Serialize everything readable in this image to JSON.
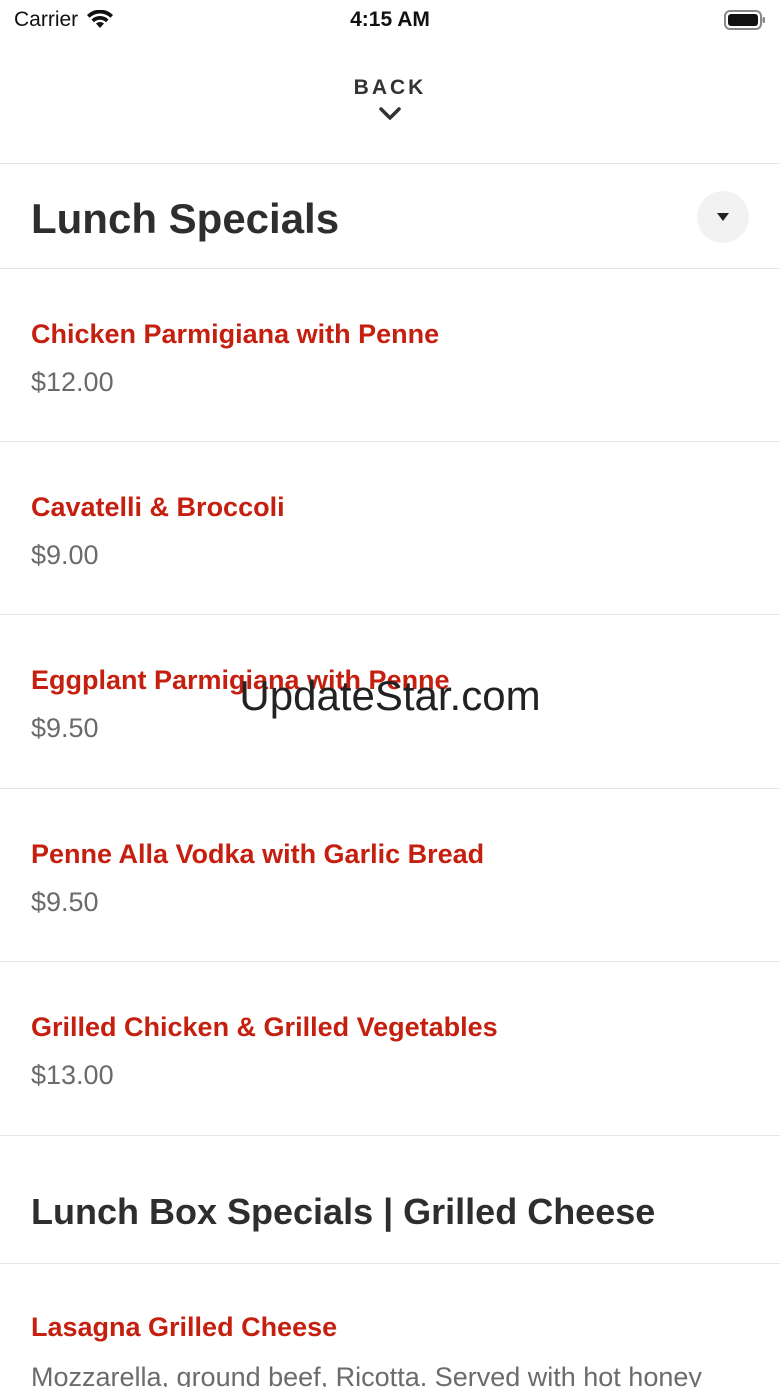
{
  "status_bar": {
    "carrier": "Carrier",
    "time": "4:15 AM",
    "icons": [
      "wifi-icon",
      "battery-icon"
    ]
  },
  "nav": {
    "back_label": "BACK",
    "back_icon": "chevron-down-icon"
  },
  "colors": {
    "item_name": "#c5200f",
    "price": "#6b6b6b",
    "title": "#2e2e2e"
  },
  "sections": [
    {
      "title": "Lunch Specials",
      "toggle_icon": "caret-down-icon",
      "items": [
        {
          "name": "Chicken Parmigiana with Penne",
          "price": "$12.00"
        },
        {
          "name": "Cavatelli & Broccoli",
          "price": "$9.00"
        },
        {
          "name": "Eggplant Parmigiana with Penne",
          "price": "$9.50"
        },
        {
          "name": "Penne Alla Vodka with Garlic Bread",
          "price": "$9.50"
        },
        {
          "name": "Grilled Chicken & Grilled Vegetables",
          "price": "$13.00"
        }
      ]
    },
    {
      "title": "Lunch Box Specials | Grilled Cheese",
      "items": [
        {
          "name": "Lasagna Grilled Cheese",
          "description": "Mozzarella, ground beef, Ricotta. Served with hot honey"
        }
      ]
    }
  ],
  "watermark": "UpdateStar.com"
}
